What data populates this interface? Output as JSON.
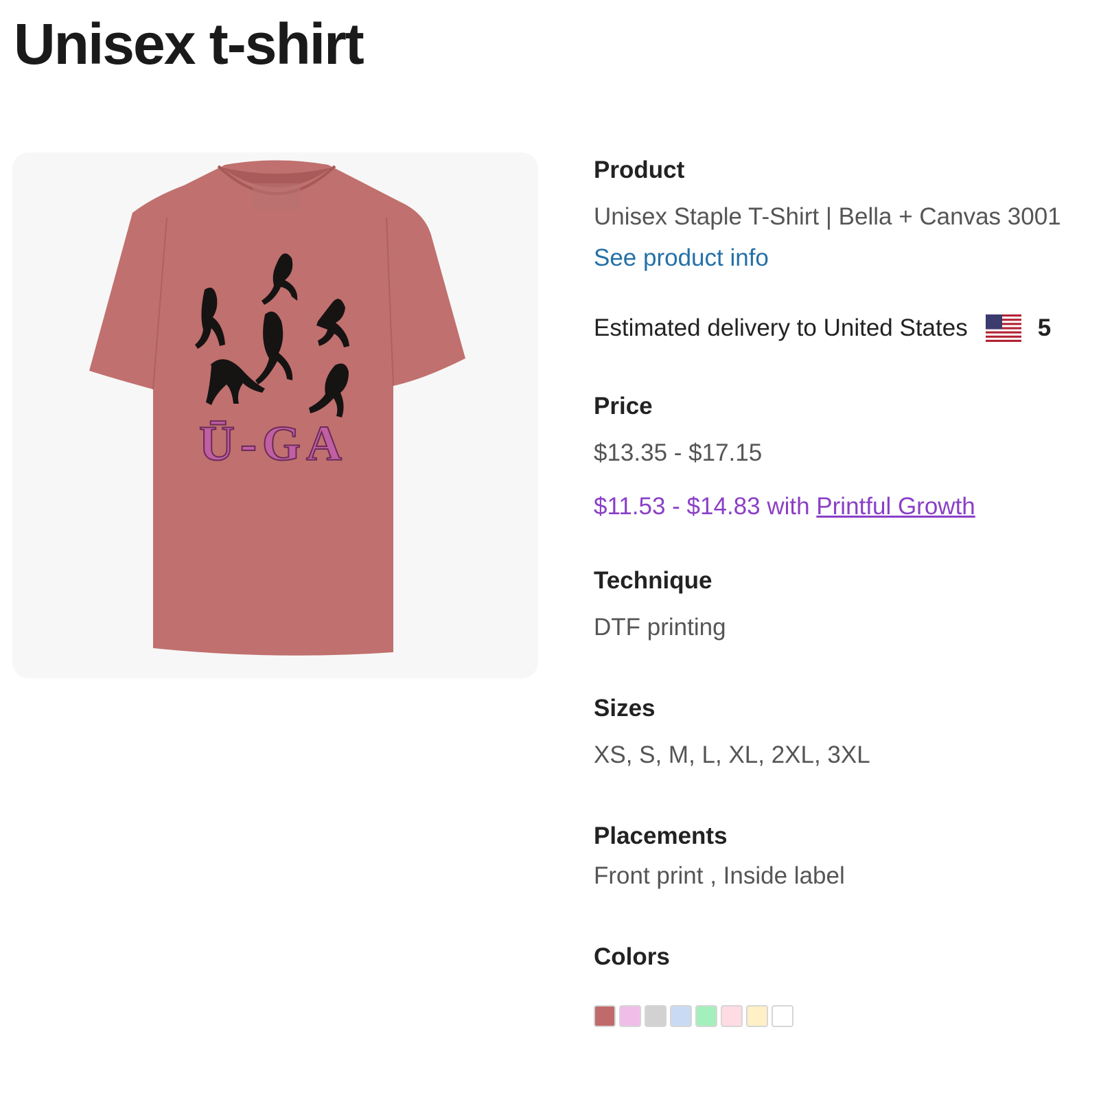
{
  "page": {
    "title": "Unisex t-shirt"
  },
  "product_image": {
    "shirt_color": "#c0706e",
    "print_text": "Ū-GA",
    "alt": "t-shirt-mockup"
  },
  "details": {
    "product": {
      "label": "Product",
      "value": "Unisex Staple T-Shirt | Bella + Canvas 3001",
      "link_label": "See product info"
    },
    "delivery": {
      "label": "Estimated delivery to United States",
      "flag_icon": "us-flag-icon",
      "days": "5"
    },
    "price": {
      "label": "Price",
      "range": "$13.35 - $17.15",
      "growth_prefix": "$11.53 - $14.83 with ",
      "growth_link": "Printful Growth"
    },
    "technique": {
      "label": "Technique",
      "value": "DTF printing"
    },
    "sizes": {
      "label": "Sizes",
      "value": "XS, S, M, L, XL, 2XL, 3XL"
    },
    "placements": {
      "label": "Placements",
      "value": "Front print , Inside label"
    },
    "colors": {
      "label": "Colors",
      "swatches": [
        "#c06a6c",
        "#f0bde8",
        "#d2d2d2",
        "#c9daf4",
        "#a4f0bc",
        "#ffdce3",
        "#fff0c6",
        "#ffffff"
      ]
    }
  },
  "theme": {
    "link_color": "#2470a8",
    "growth_color": "#8a3fc7"
  }
}
